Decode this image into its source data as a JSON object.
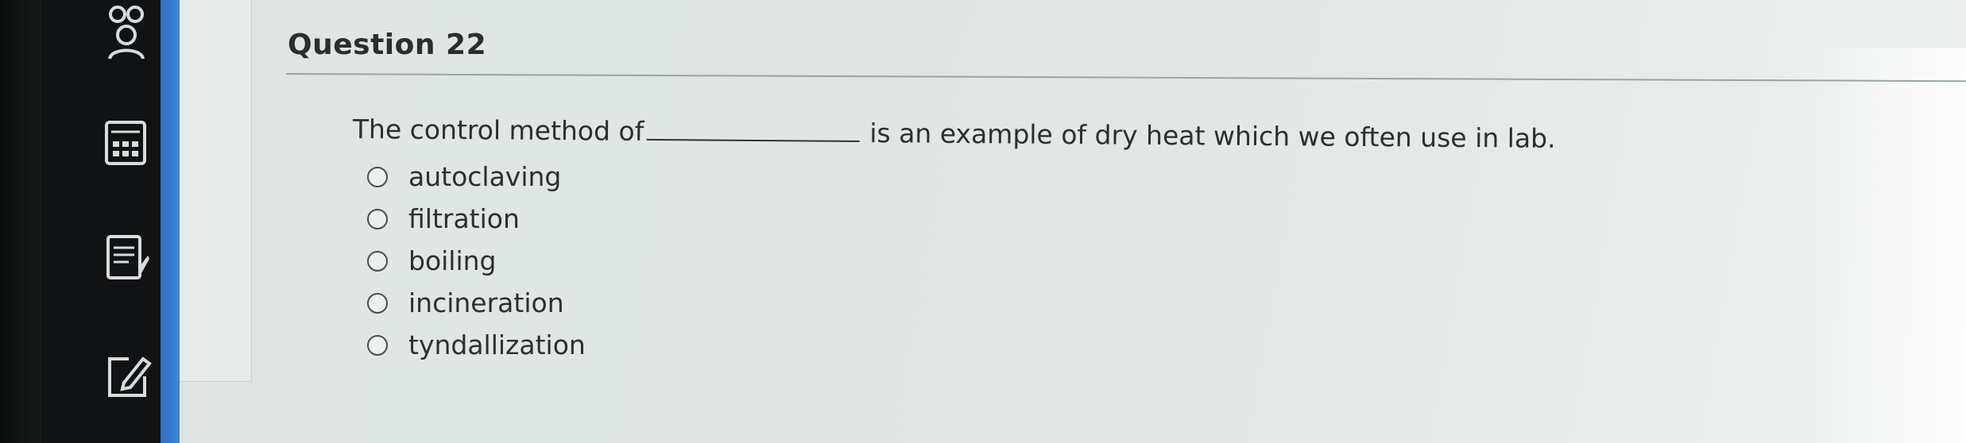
{
  "question": {
    "title": "Question 22",
    "text_before_blank": "The control method of",
    "text_after_blank": "is an example of dry heat which we often use in lab.",
    "options": [
      {
        "label": "autoclaving",
        "selected": false
      },
      {
        "label": "filtration",
        "selected": false
      },
      {
        "label": "boiling",
        "selected": false
      },
      {
        "label": "incineration",
        "selected": false
      },
      {
        "label": "tyndallization",
        "selected": false
      }
    ]
  },
  "sidebar": {
    "icons": [
      "people-icon",
      "calculator-icon",
      "notes-icon",
      "edit-icon"
    ]
  },
  "colors": {
    "sidebar_bg": "#101214",
    "accent_blue": "#2b6fc2",
    "content_bg": "#e2e7e5"
  }
}
